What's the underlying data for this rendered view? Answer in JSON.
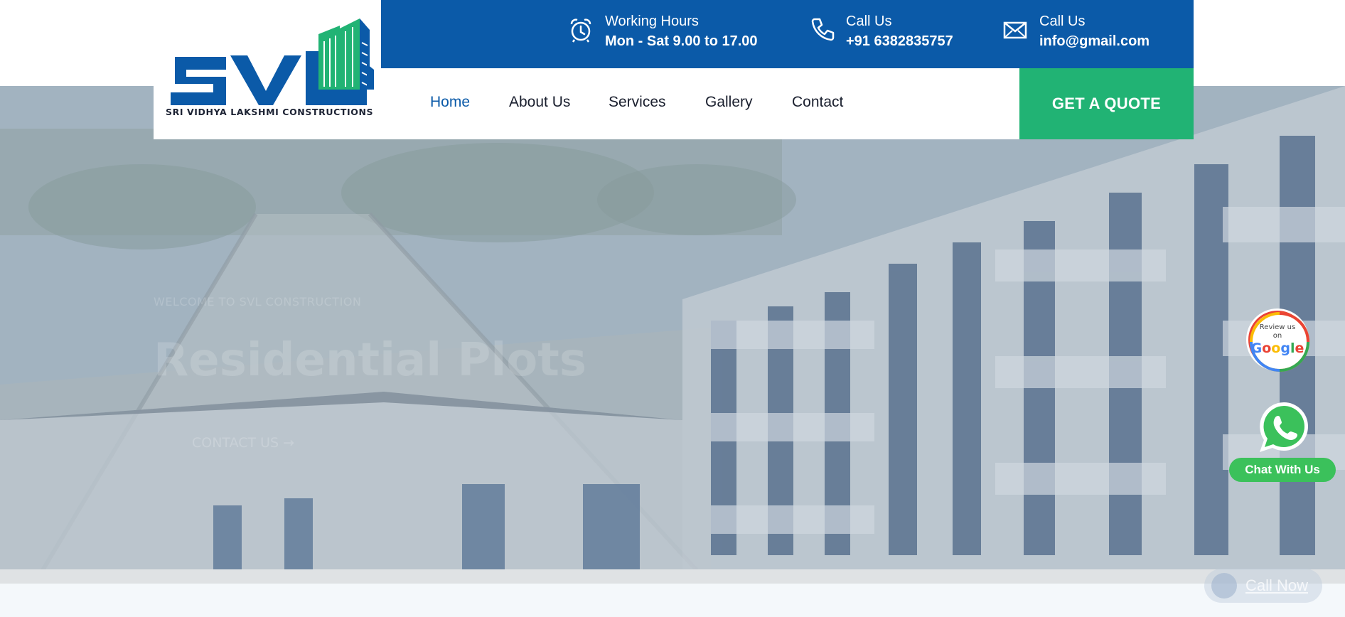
{
  "logo": {
    "letters": "SVL",
    "tagline": "SRI VIDHYA LAKSHMI CONSTRUCTIONS",
    "colors": {
      "primary": "#0b5aa8",
      "accent": "#21b374"
    }
  },
  "topbar": {
    "hours": {
      "label": "Working Hours",
      "value": "Mon - Sat 9.00 to 17.00",
      "icon": "alarm-clock-icon"
    },
    "phone": {
      "label": "Call Us",
      "value": "+91 6382835757",
      "icon": "phone-icon"
    },
    "email": {
      "label": "Call Us",
      "value": "info@gmail.com",
      "icon": "envelope-icon"
    }
  },
  "nav": {
    "items": [
      "Home",
      "About Us",
      "Services",
      "Gallery",
      "Contact"
    ],
    "active": "Home"
  },
  "quote_button": "GET A QUOTE",
  "hero": {
    "kicker": "WELCOME TO SVL CONSTRUCTION",
    "title": "Residential Plots",
    "cta": "CONTACT US →"
  },
  "floating": {
    "google": {
      "line1": "Review us",
      "line2": "on",
      "brand": "Google"
    },
    "whatsapp": "Chat With Us",
    "call_now": "Call Now"
  }
}
